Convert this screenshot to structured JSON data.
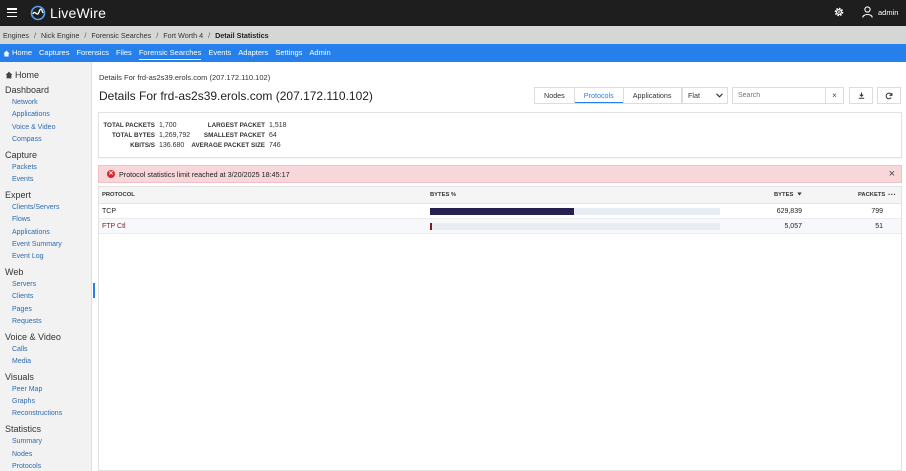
{
  "app": {
    "name": "LiveWire",
    "user": "admin"
  },
  "breadcrumbs": [
    "Engines",
    "Nick Engine",
    "Forensic Searches",
    "Fort Worth 4",
    "Detail Statistics"
  ],
  "nav": [
    "Home",
    "Captures",
    "Forensics",
    "Files",
    "Forensic Searches",
    "Events",
    "Adapters",
    "Settings",
    "Admin"
  ],
  "nav_active": "Forensic Searches",
  "sidebar": {
    "home": "Home",
    "sections": [
      {
        "title": "Dashboard",
        "items": [
          "Network",
          "Applications",
          "Voice & Video",
          "Compass"
        ]
      },
      {
        "title": "Capture",
        "items": [
          "Packets",
          "Events"
        ]
      },
      {
        "title": "Expert",
        "items": [
          "Clients/Servers",
          "Flows",
          "Applications",
          "Event Summary",
          "Event Log"
        ]
      },
      {
        "title": "Web",
        "items": [
          "Servers",
          "Clients",
          "Pages",
          "Requests"
        ]
      },
      {
        "title": "Voice & Video",
        "items": [
          "Calls",
          "Media"
        ]
      },
      {
        "title": "Visuals",
        "items": [
          "Peer Map",
          "Graphs",
          "Reconstructions"
        ]
      },
      {
        "title": "Statistics",
        "items": [
          "Summary",
          "Nodes",
          "Protocols"
        ]
      }
    ]
  },
  "page": {
    "subtitle": "Details For frd-as2s39.erols.com (207.172.110.102)",
    "title": "Details For frd-as2s39.erols.com (207.172.110.102)"
  },
  "tabs": [
    "Nodes",
    "Protocols",
    "Applications"
  ],
  "active_tab": "Protocols",
  "view_select": "Flat",
  "search": {
    "placeholder": "Search",
    "clear": "×"
  },
  "stats": {
    "total_packets_label": "TOTAL PACKETS",
    "total_packets": "1,700",
    "total_bytes_label": "TOTAL BYTES",
    "total_bytes": "1,269,792",
    "kbits_label": "KBITS/S",
    "kbits": "136.680",
    "largest_label": "LARGEST PACKET",
    "largest": "1,518",
    "smallest_label": "SMALLEST PACKET",
    "smallest": "64",
    "avg_label": "AVERAGE PACKET SIZE",
    "avg": "746"
  },
  "alert": {
    "text": "Protocol statistics limit reached at 3/20/2025 18:45:17",
    "close": "×"
  },
  "table": {
    "headers": {
      "protocol": "PROTOCOL",
      "bytes_pct": "BYTES %",
      "bytes": "BYTES",
      "packets": "PACKETS",
      "more": "···"
    },
    "rows": [
      {
        "protocol": "TCP",
        "bytes_pct": 0.496,
        "bytes": "629,839",
        "packets": "799",
        "protocol_color": "#222222",
        "bar_color": "#25204f"
      },
      {
        "protocol": "FTP Ctl",
        "bytes_pct": 0.004,
        "bytes": "5,057",
        "packets": "51",
        "protocol_color": "#8b1d1d",
        "bar_color": "#7a1f1f"
      }
    ]
  },
  "colors": {
    "accent": "#2680eb",
    "topbar": "#1e1e1e",
    "alert_bg": "#f8d7da",
    "alert_icon": "#d9252d"
  },
  "icons": {
    "menu": "hamburger-icon",
    "logo": "livewire-logo-icon",
    "settings": "gear-icon",
    "user": "user-icon",
    "home": "home-icon",
    "download": "download-icon",
    "refresh": "refresh-icon",
    "error": "error-icon",
    "sort": "sort-desc-icon",
    "close": "close-icon"
  }
}
